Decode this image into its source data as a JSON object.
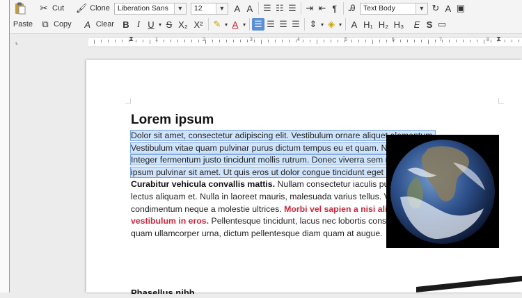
{
  "toolbar": {
    "paste": "Paste",
    "cut": "Cut",
    "copy": "Copy",
    "clone": "Clone",
    "clear": "Clear",
    "font_name": "Liberation Sans",
    "font_size": "12",
    "paragraph_style": "Text Body",
    "bold": "B",
    "italic": "I",
    "underline": "U",
    "strike": "S",
    "subscript": "X₂",
    "superscript": "X²",
    "h1": "H₁",
    "h2": "H₂",
    "h3": "H₃",
    "style_e": "E",
    "style_s": "S",
    "style_a": "A"
  },
  "ruler": {
    "numbers": [
      "1",
      "2",
      "3",
      "4",
      "5",
      "6",
      "7",
      "8",
      "9"
    ]
  },
  "document": {
    "heading": "Lorem ipsum",
    "selected_text": "Dolor sit amet, consectetur adipiscing elit. Vestibulum ornare aliquet elementum. Vestibulum vitae quam pulvinar purus dictum tempus eu et quam. Nulla facilisi. Integer fermentum justo tincidunt mollis rutrum. Donec viverra sem massa, a ultrices ipsum pulvinar sit amet. Ut quis eros ut dolor congue tincidunt eget at nulla.",
    "bold_text": "Curabitur vehicula convallis mattis.",
    "normal_text_1": "Nullam consectetur iaculis purus, in consequat lectus aliquam et. Nulla in laoreet mauris, malesuada varius tellus. Vivamus condimentum neque a molestie ultrices.",
    "red_text": "Morbi vel sapien a nisi aliquam ultricies vestibulum in eros.",
    "normal_text_2": "Pellentesque tincidunt, lacus nec lobortis consectetur, neque quam ullamcorper urna, dictum pellentesque diam quam at augue.",
    "next_heading": "Phasellus nibh"
  },
  "image": {
    "alt": "earth-globe-image"
  },
  "colors": {
    "selection": "#cfe4fb",
    "red_text": "#c8263b",
    "active_button": "#5a8fd6"
  }
}
